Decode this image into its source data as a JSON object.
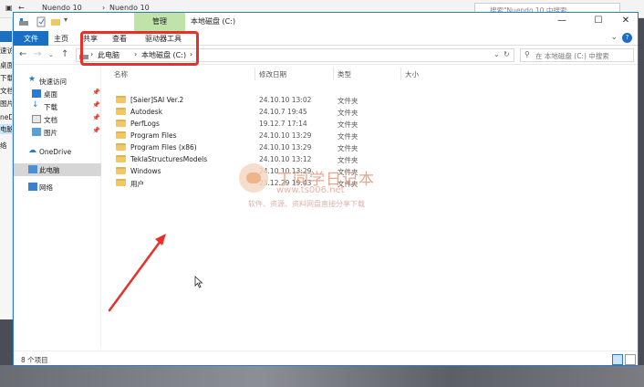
{
  "bg_window": {
    "breadcrumb_app": "Nuendo 10",
    "breadcrumb_folder": "Nuendo 10",
    "search_placeholder": "搜索\"Nuendo 10 中搜索",
    "left_strip": [
      "速访",
      "桌面",
      "下载",
      "文档",
      "图片",
      "neD",
      "电脑",
      "络"
    ]
  },
  "window": {
    "title": "本地磁盘 (C:)",
    "manage_tab": "管理",
    "ribbon_tabs": [
      "文件",
      "主页",
      "共享",
      "查看",
      "驱动器工具"
    ],
    "address": {
      "crumbs": [
        "此电脑",
        "本地磁盘 (C:)"
      ]
    },
    "search_placeholder": "在 本地磁盘 (C:) 中搜索"
  },
  "nav": {
    "quick_access": "快速访问",
    "quick_items": [
      "桌面",
      "下载",
      "文档",
      "图片"
    ],
    "onedrive": "OneDrive",
    "this_pc": "此电脑",
    "network": "网络"
  },
  "columns": [
    "名称",
    "修改日期",
    "类型",
    "大小"
  ],
  "files": [
    {
      "name": "[Saier]SAI Ver.2",
      "date": "24.10.10 13:02",
      "type": "文件夹"
    },
    {
      "name": "Autodesk",
      "date": "24.10.7 19:45",
      "type": "文件夹"
    },
    {
      "name": "PerfLogs",
      "date": "19.12.7 17:14",
      "type": "文件夹"
    },
    {
      "name": "Program Files",
      "date": "24.10.10 13:29",
      "type": "文件夹"
    },
    {
      "name": "Program Files (x86)",
      "date": "24.10.10 13:29",
      "type": "文件夹"
    },
    {
      "name": "TeklaStructuresModels",
      "date": "24.10.10 13:12",
      "type": "文件夹"
    },
    {
      "name": "Windows",
      "date": "24.10.10 13:29",
      "type": "文件夹"
    },
    {
      "name": "用户",
      "date": "23.12.29 19:43",
      "type": "文件夹"
    }
  ],
  "status": {
    "count": "8 个项目"
  },
  "watermark": {
    "title": "丁同学日记本",
    "url": "www.ts006.net",
    "sub": "软件、资源、资料网盘直接分享下载"
  },
  "colors": {
    "accent": "#1a6fc4",
    "manage": "#bfe3a8",
    "annotation": "#e8302a",
    "folder": "#f0c864"
  }
}
